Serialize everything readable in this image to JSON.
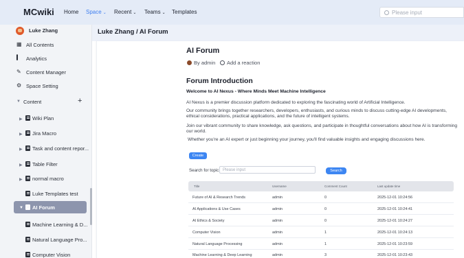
{
  "header": {
    "logo": "MCwiki",
    "nav": [
      {
        "label": "Home",
        "caret": false
      },
      {
        "label": "Space",
        "caret": true
      },
      {
        "label": "Recent",
        "caret": true
      },
      {
        "label": "Teams",
        "caret": true
      },
      {
        "label": "Templates",
        "caret": false
      }
    ],
    "search_placeholder": "Please input"
  },
  "sidebar": {
    "user_name": "Luke Zhang",
    "menu": [
      "All Contents",
      "Analytics",
      "Content Manager",
      "Space Setting"
    ],
    "content_label": "Content",
    "add_symbol": "+",
    "tree": [
      "Wiki Plan",
      "Jira Macro",
      "Task and content repor...",
      "Table Filter",
      "normal macro",
      "Luke Templates test",
      "AI Forum",
      "Machine Learning & D...",
      "Natural Language Pro...",
      "Computer Vision"
    ]
  },
  "main": {
    "breadcrumb": "Luke Zhang / AI Forum",
    "title": "AI Forum",
    "author": "By admin",
    "reaction": "Add a reaction",
    "section_title": "Forum Introduction",
    "welcome": "Welcome to AI Nexus - Where Minds Meet Machine Intelligence",
    "paragraphs": [
      "AI Nexus is a premier discussion platform dedicated to exploring the fascinating world of Artificial Intelligence.",
      "Our community brings together researchers, developers, enthusiasts, and curious minds to discuss cutting-edge AI developments, ethical considerations, practical applications, and the future of intelligent systems.",
      "Join our vibrant community to share knowledge, ask questions, and participate in thoughtful conversations about how AI is transforming our world.",
      "Whether you're an AI expert or just beginning your journey, you'll find valuable insights and engaging discussions here."
    ],
    "create_label": "Create",
    "search_label": "Search for topic",
    "search_placeholder": "Please input",
    "search_button": "Search",
    "table": {
      "columns": [
        "Title",
        "Username",
        "Comment Count",
        "Last update time"
      ],
      "rows": [
        [
          "Future of AI & Research Trends",
          "admin",
          "0",
          "2025-12-01 10:24:56"
        ],
        [
          "AI Applications & Use Cases",
          "admin",
          "0",
          "2025-12-01 10:24:41"
        ],
        [
          "AI Ethics & Society",
          "admin",
          "0",
          "2025-12-01 10:24:27"
        ],
        [
          "Computer Vision",
          "admin",
          "1",
          "2025-12-01 10:24:13"
        ],
        [
          "Natural Language Processing",
          "admin",
          "1",
          "2025-12-01 10:23:59"
        ],
        [
          "Machine Learning & Deep Learning",
          "admin",
          "3",
          "2025-12-01 10:23:43"
        ]
      ]
    }
  },
  "colors": {
    "accent": "#3d86f2",
    "nav_active": "#3d7ef0",
    "topbar": "#e4ebf7",
    "sidebar_active": "#8d95ad"
  }
}
